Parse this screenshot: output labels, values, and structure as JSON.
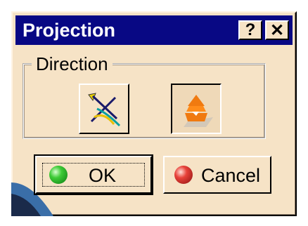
{
  "dialog": {
    "title": "Projection",
    "help_label": "?",
    "close_label": "✕"
  },
  "direction": {
    "group_label": "Direction",
    "options": [
      {
        "name": "along-direction",
        "icon": "projection-along-direction-icon",
        "pressed": false
      },
      {
        "name": "normal",
        "icon": "projection-normal-icon",
        "pressed": true
      }
    ]
  },
  "buttons": {
    "ok_label": "OK",
    "cancel_label": "Cancel"
  },
  "colors": {
    "title_bar": "#080884",
    "dialog_bg": "#f6e3c6",
    "ok_ball": "#3ecb36",
    "cancel_ball": "#e8423a"
  }
}
